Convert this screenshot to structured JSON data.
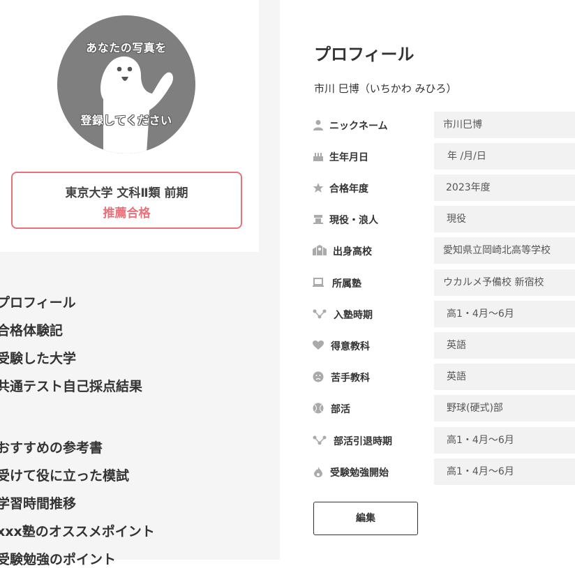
{
  "avatar": {
    "line1": "あなたの写真を",
    "line2": "登録してください"
  },
  "university": {
    "name": "東京大学 文科Ⅱ類 前期",
    "result": "推薦合格"
  },
  "menu": [
    "プロフィール",
    "合格体験記",
    "受験した大学",
    "共通テスト自己採点結果",
    "おすすめの参考書",
    "受けて役に立った模試",
    "学習時間推移",
    "xxx塾のオススメポイント",
    "受験勉強のポイント"
  ],
  "profile": {
    "title": "プロフィール",
    "fullname": "市川 巳博（いちかわ みひろ）",
    "fields": [
      {
        "label": "ニックネーム",
        "value": "市川巳博",
        "icon": "person-icon"
      },
      {
        "label": "生年月日",
        "value": "年 /月/日",
        "icon": "cake-icon"
      },
      {
        "label": "合格年度",
        "value": "2023年度",
        "icon": "star-icon"
      },
      {
        "label": "現役・浪人",
        "value": "現役",
        "icon": "graduation-cap-icon"
      },
      {
        "label": "出身高校",
        "value": "愛知県立岡崎北高等学校",
        "icon": "school-icon"
      },
      {
        "label": "所属塾",
        "value": "ウカルメ予備校 新宿校",
        "icon": "laptop-icon"
      },
      {
        "label": "入塾時期",
        "value": "高1・4月〜6月",
        "icon": "timeline-icon"
      },
      {
        "label": "得意教科",
        "value": "英語",
        "icon": "heart-icon"
      },
      {
        "label": "苦手教科",
        "value": "英語",
        "icon": "sad-face-icon"
      },
      {
        "label": "部活",
        "value": "野球(硬式)部",
        "icon": "ball-icon"
      },
      {
        "label": "部活引退時期",
        "value": "高1・4月〜6月",
        "icon": "timeline-icon"
      },
      {
        "label": "受験勉強開始",
        "value": "高1・4月〜6月",
        "icon": "flame-icon"
      }
    ],
    "edit_label": "編集"
  },
  "colors": {
    "accent": "#e8717a",
    "icon": "#aaaaaa",
    "value_bg": "#f2f2f2"
  }
}
